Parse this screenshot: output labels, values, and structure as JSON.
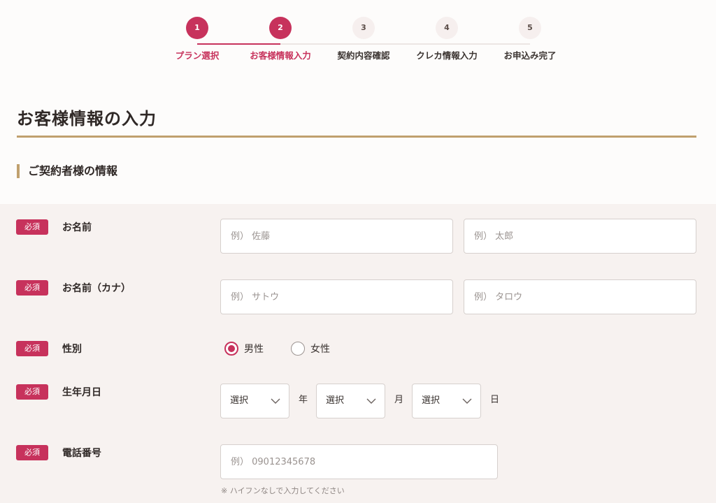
{
  "stepper": {
    "steps": [
      {
        "number": "1",
        "label": "プラン選択"
      },
      {
        "number": "2",
        "label": "お客様情報入力"
      },
      {
        "number": "3",
        "label": "契約内容確認"
      },
      {
        "number": "4",
        "label": "クレカ情報入力"
      },
      {
        "number": "5",
        "label": "お申込み完了"
      }
    ]
  },
  "page_title": "お客様情報の入力",
  "section_heading": "ご契約者様の情報",
  "required_label": "必須",
  "form": {
    "name": {
      "label": "お名前",
      "last_placeholder": "例） 佐藤",
      "first_placeholder": "例） 太郎"
    },
    "name_kana": {
      "label": "お名前（カナ）",
      "last_placeholder": "例） サトウ",
      "first_placeholder": "例） タロウ"
    },
    "gender": {
      "label": "性別",
      "options": [
        "男性",
        "女性"
      ],
      "selected": "男性"
    },
    "birthday": {
      "label": "生年月日",
      "year_value": "選択",
      "month_value": "選択",
      "day_value": "選択",
      "year_unit": "年",
      "month_unit": "月",
      "day_unit": "日"
    },
    "phone": {
      "label": "電話番号",
      "placeholder": "例） 09012345678",
      "note": "※ ハイフンなしで入力してください"
    }
  },
  "colors": {
    "accent": "#c7325c",
    "gold_rule": "#c0a06e",
    "panel_bg": "#f7f2f0"
  },
  "icons": {
    "select_arrow": "chevron-down-icon"
  }
}
